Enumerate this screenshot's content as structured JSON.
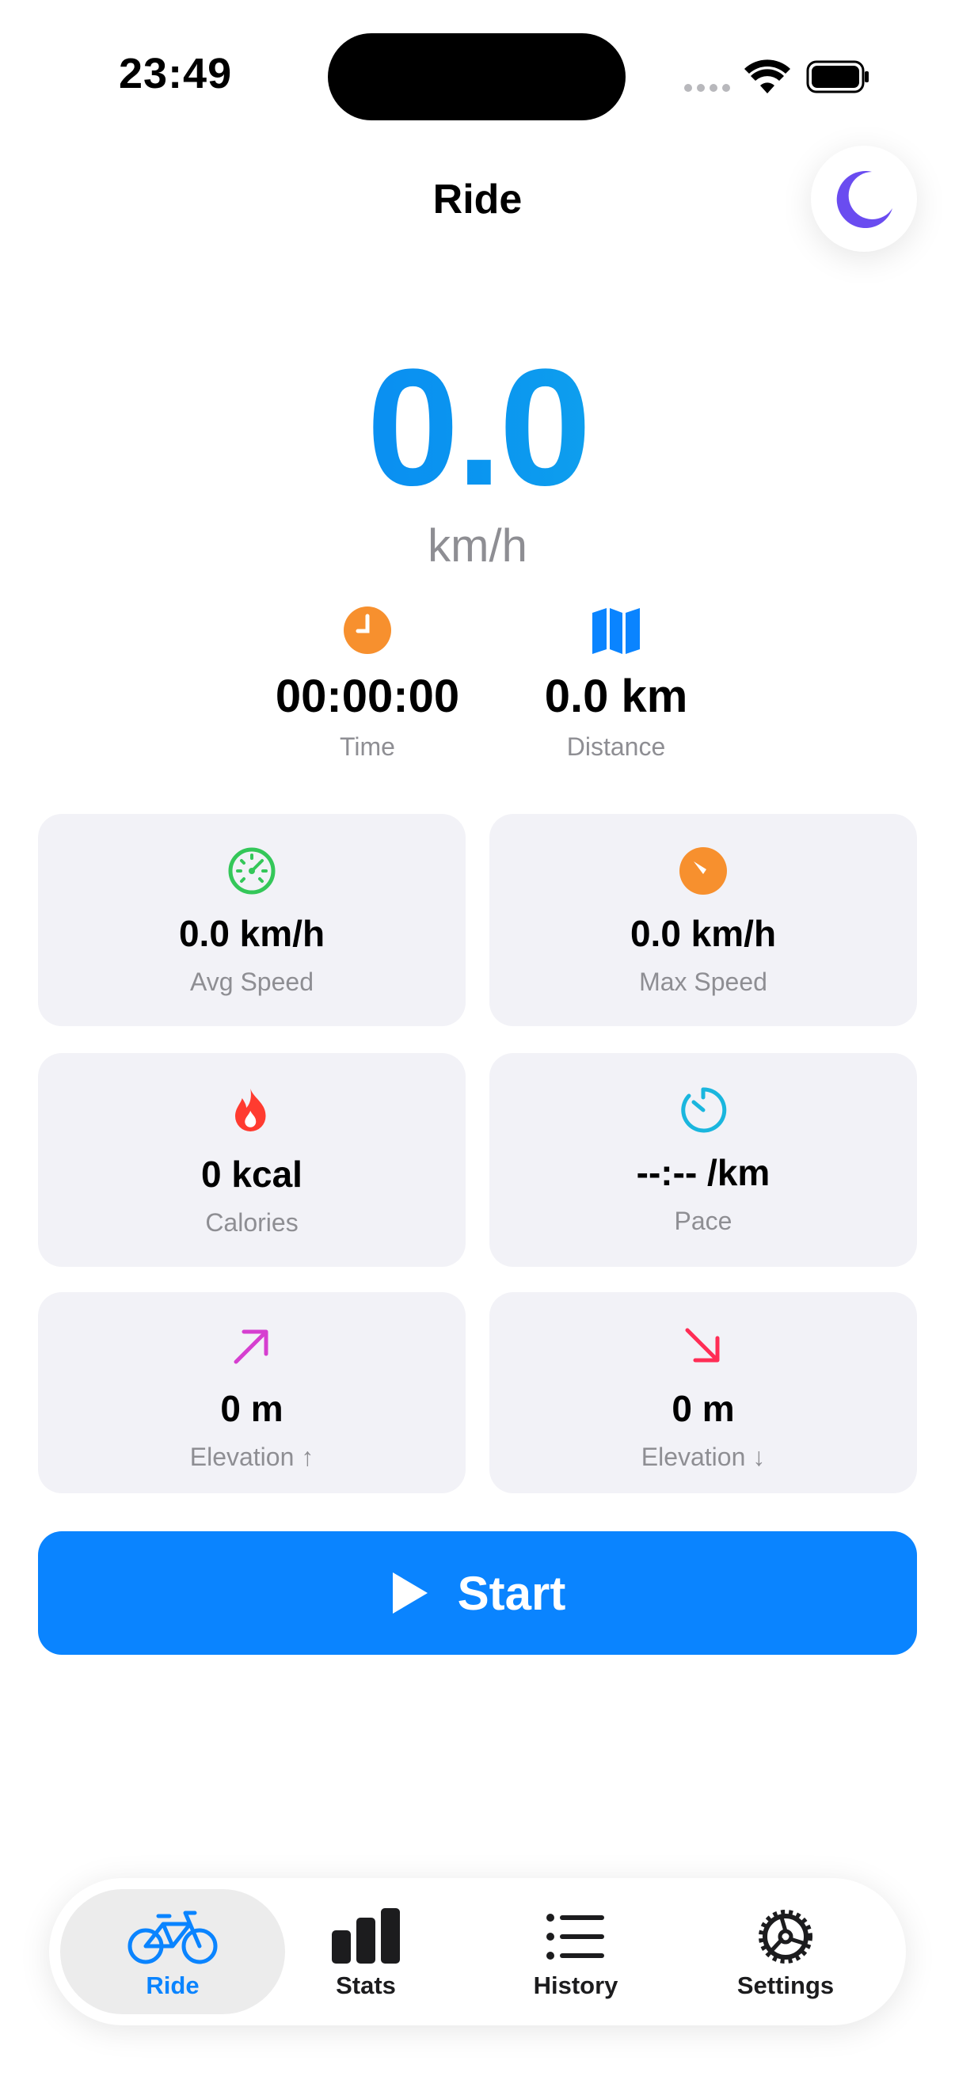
{
  "status_bar": {
    "time": "23:49"
  },
  "header": {
    "title": "Ride",
    "theme_icon": "moon-icon"
  },
  "speed": {
    "value": "0.0",
    "unit": "km/h"
  },
  "primary_stats": [
    {
      "icon": "clock-icon",
      "value": "00:00:00",
      "label": "Time",
      "color": "#f7902e"
    },
    {
      "icon": "map-icon",
      "value": "0.0 km",
      "label": "Distance",
      "color": "#0a84ff"
    }
  ],
  "cards": [
    {
      "icon": "speedometer-icon",
      "value": "0.0 km/h",
      "label": "Avg Speed",
      "color": "#34c759"
    },
    {
      "icon": "gauge-icon",
      "value": "0.0 km/h",
      "label": "Max Speed",
      "color": "#f7902e"
    },
    {
      "icon": "flame-icon",
      "value": "0 kcal",
      "label": "Calories",
      "color": "#ff3b30"
    },
    {
      "icon": "timer-icon",
      "value": "--:-- /km",
      "label": "Pace",
      "color": "#1ab6de"
    },
    {
      "icon": "arrow-up-right-icon",
      "value": "0 m",
      "label": "Elevation ↑",
      "color": "#d63fd0"
    },
    {
      "icon": "arrow-down-right-icon",
      "value": "0 m",
      "label": "Elevation ↓",
      "color": "#ff2d55"
    }
  ],
  "start_button": {
    "label": "Start",
    "icon": "play-icon"
  },
  "tabs": [
    {
      "label": "Ride",
      "icon": "bicycle-icon",
      "active": true
    },
    {
      "label": "Stats",
      "icon": "bar-chart-icon",
      "active": false
    },
    {
      "label": "History",
      "icon": "list-icon",
      "active": false
    },
    {
      "label": "Settings",
      "icon": "gear-icon",
      "active": false
    }
  ],
  "colors": {
    "accent": "#0a84ff",
    "card_bg": "#f2f2f7",
    "secondary_text": "#8e8e93"
  }
}
